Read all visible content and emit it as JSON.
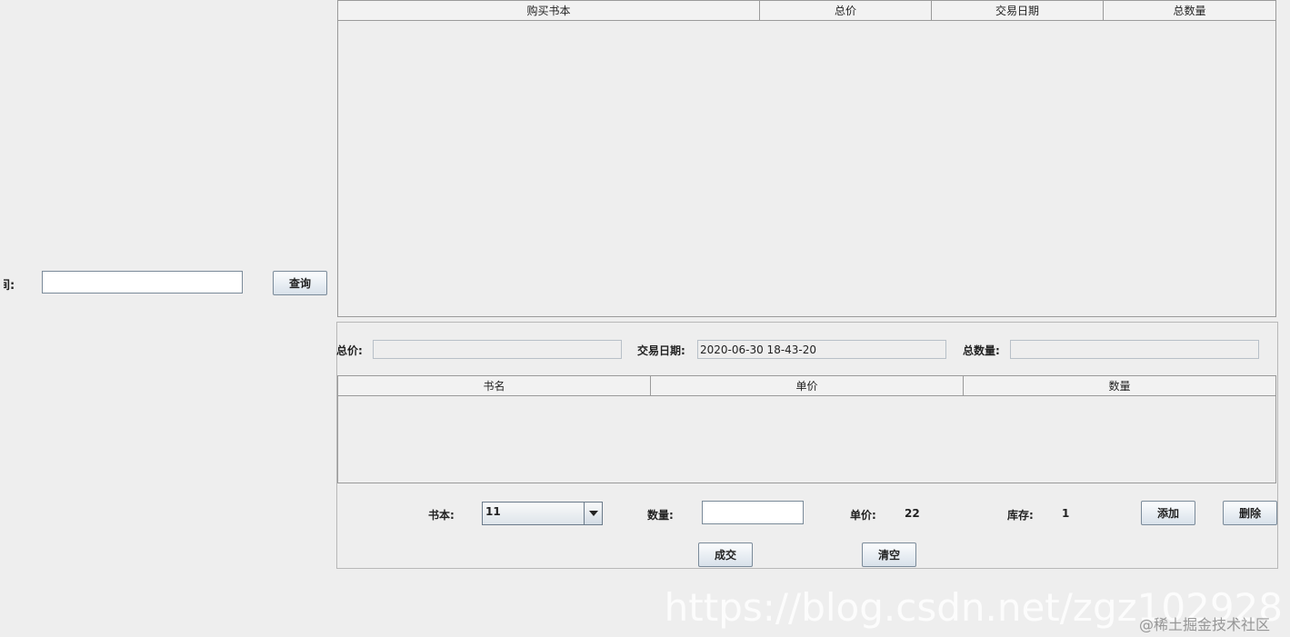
{
  "search": {
    "label_fragment": "间:",
    "query_button": "查询"
  },
  "orders_table": {
    "columns": [
      "购买书本",
      "总价",
      "交易日期",
      "总数量"
    ]
  },
  "detail": {
    "total_price_label": "总价:",
    "total_price_value": "",
    "date_label": "交易日期:",
    "date_value": "2020-06-30 18-43-20",
    "total_qty_label": "总数量:",
    "total_qty_value": ""
  },
  "items_table": {
    "columns": [
      "书名",
      "单价",
      "数量"
    ]
  },
  "entry": {
    "book_label": "书本:",
    "book_selected": "11",
    "qty_label": "数量:",
    "qty_value": "",
    "price_label": "单价:",
    "price_value": "22",
    "stock_label": "库存:",
    "stock_value": "1",
    "add_button": "添加",
    "delete_button": "删除",
    "deal_button": "成交",
    "clear_button": "清空"
  },
  "watermark": {
    "url": "https://blog.csdn.net/zgz102928",
    "community": "@稀土掘金技术社区"
  }
}
